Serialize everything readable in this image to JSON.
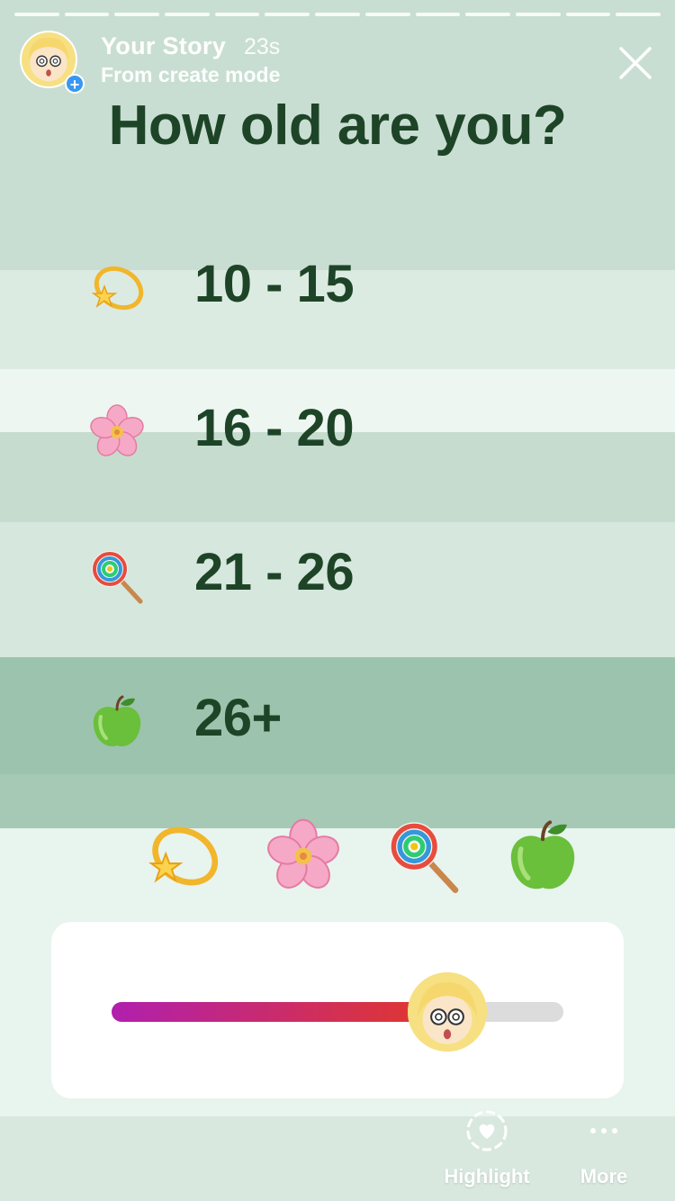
{
  "story": {
    "owner": "Your Story",
    "time": "23s",
    "subtitle": "From create mode",
    "segments": 13
  },
  "question": "How old are you?",
  "options": [
    {
      "emoji": "dizzy-star-icon",
      "label": "10 - 15"
    },
    {
      "emoji": "cherry-blossom-icon",
      "label": "16 - 20"
    },
    {
      "emoji": "lollipop-icon",
      "label": "21 - 26"
    },
    {
      "emoji": "green-apple-icon",
      "label": "26+"
    }
  ],
  "emoji_row": [
    "dizzy-star-icon",
    "cherry-blossom-icon",
    "lollipop-icon",
    "green-apple-icon"
  ],
  "slider": {
    "value": 0.72,
    "gradient_start": "#b11fae",
    "gradient_end": "#e2372b",
    "thumb_icon": "avatar-face-icon"
  },
  "actions": {
    "highlight_label": "Highlight",
    "more_label": "More"
  },
  "colors": {
    "text_dark_green": "#1e4428",
    "background": "#e4f0ea",
    "brush_green": "#9cc3ad"
  }
}
